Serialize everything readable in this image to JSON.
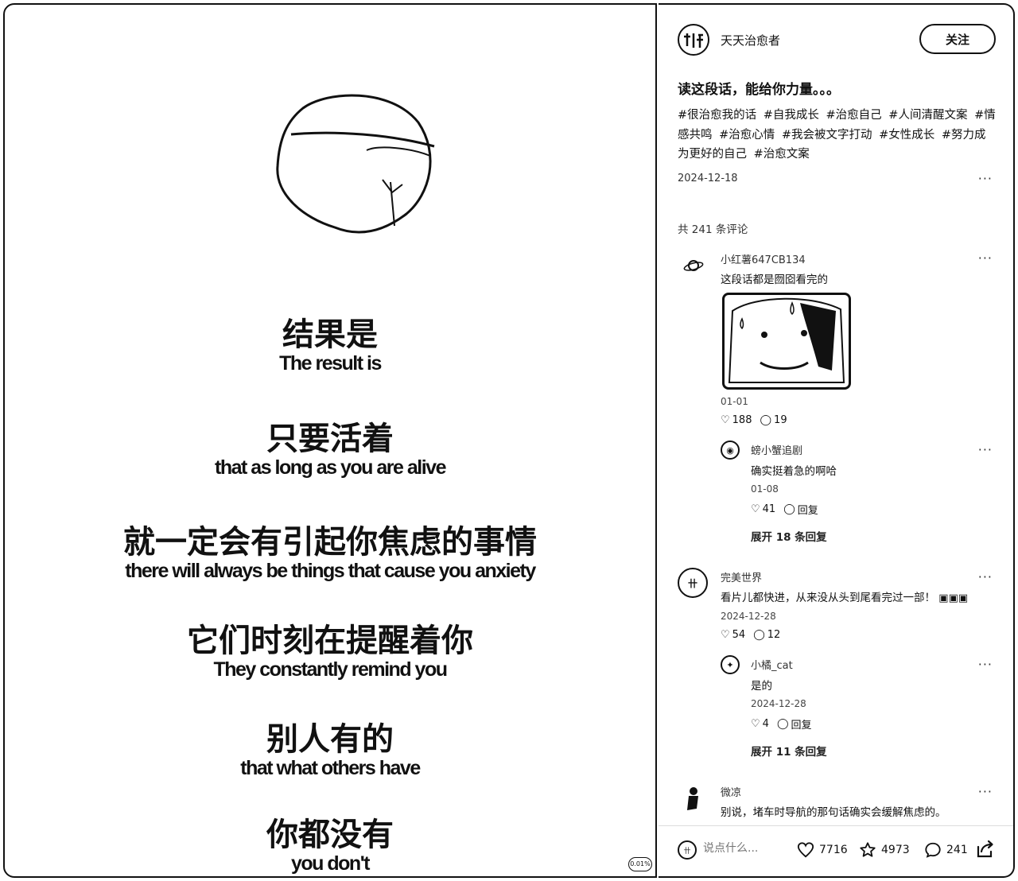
{
  "video": {
    "subtitles": [
      {
        "zh": "结果是",
        "en": "The result is"
      },
      {
        "zh": "只要活着",
        "en": "that as long as you are alive"
      },
      {
        "zh": "就一定会有引起你焦虑的事情",
        "en": "there will always be things that cause you anxiety"
      },
      {
        "zh": "它们时刻在提醒着你",
        "en": "They constantly remind you"
      },
      {
        "zh": "别人有的",
        "en": "that what others have"
      },
      {
        "zh": "你都没有",
        "en": "you don't"
      }
    ],
    "corner_badge": "0.01%"
  },
  "author": {
    "name": "天天治愈者",
    "follow_label": "关注"
  },
  "post": {
    "title": "读这段话，能给你力量。。。",
    "tags": [
      "#很治愈我的话",
      "#自我成长",
      "#治愈自己",
      "#人间清醒文案",
      "#情感共鸣",
      "#治愈心情",
      "#我会被文字打动",
      "#女性成长",
      "#努力成为更好的自己",
      "#治愈文案"
    ],
    "date": "2024-12-18",
    "comment_total": "共 241 条评论"
  },
  "comments": [
    {
      "name": "小红薯647CB134",
      "text": "这段话都是囫囵看完的",
      "date": "01-01",
      "likes": "188",
      "replies": "19",
      "sub": {
        "name": "螃小蟹追剧",
        "text": "确实挺着急的啊哈",
        "date": "01-08",
        "likes": "41",
        "reply_label": "回复"
      },
      "expand": "展开 18 条回复"
    },
    {
      "name": "完美世界",
      "text": "看片儿都快进，从来没从头到尾看完过一部！",
      "date": "2024-12-28",
      "likes": "54",
      "replies": "12",
      "sub": {
        "name": "小橘_cat",
        "text": "是的",
        "date": "2024-12-28",
        "likes": "4",
        "reply_label": "回复"
      },
      "expand": "展开 11 条回复"
    },
    {
      "name": "微凉",
      "text": "别说，堵车时导航的那句话确实会缓解焦虑的。"
    }
  ],
  "bottom": {
    "placeholder": "说点什么...",
    "likes": "7716",
    "stars": "4973",
    "comments": "241"
  }
}
